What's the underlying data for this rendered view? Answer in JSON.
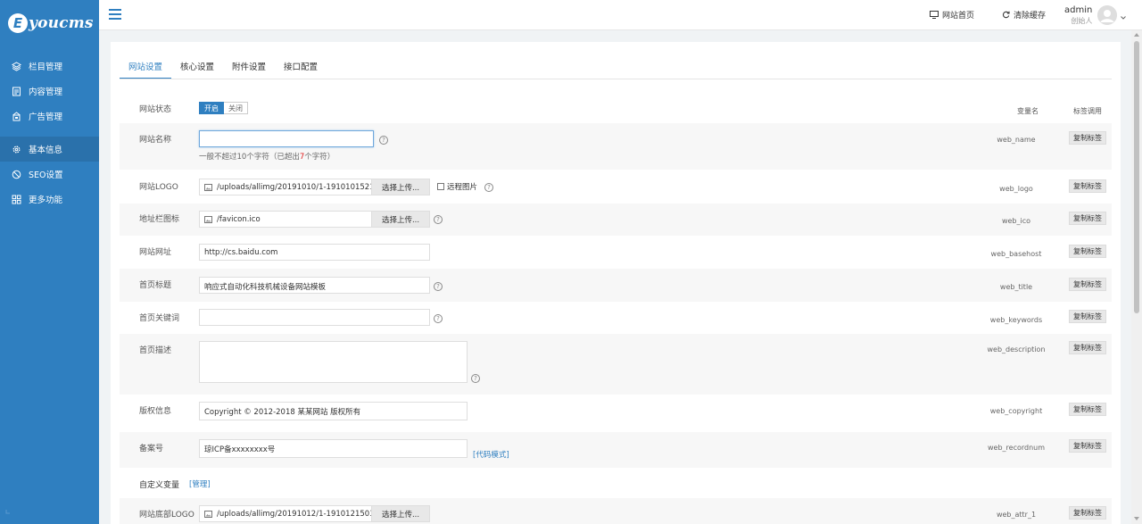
{
  "logo": {
    "mark": "E",
    "text": "youcms"
  },
  "sidebar": {
    "items": [
      {
        "label": "栏目管理",
        "icon": "layers-icon"
      },
      {
        "label": "内容管理",
        "icon": "document-icon"
      },
      {
        "label": "广告管理",
        "icon": "ad-icon"
      },
      {
        "label": "基本信息",
        "icon": "gear-icon",
        "active": true
      },
      {
        "label": "SEO设置",
        "icon": "seo-icon"
      },
      {
        "label": "更多功能",
        "icon": "grid-icon"
      }
    ]
  },
  "header": {
    "home_link": "网站首页",
    "clear_cache": "清除缓存",
    "user_name": "admin",
    "user_role": "创始人"
  },
  "tabs": [
    {
      "label": "网站设置",
      "active": true
    },
    {
      "label": "核心设置"
    },
    {
      "label": "附件设置"
    },
    {
      "label": "接口配置"
    }
  ],
  "columns": {
    "var_name": "变量名",
    "tag_call": "标签调用"
  },
  "copy_label": "复制标签",
  "site_status": {
    "label": "网站状态",
    "on": "开启",
    "off": "关闭"
  },
  "fields": {
    "web_name": {
      "label": "网站名称",
      "value": "",
      "hint_pre": "一般不超过10个字符（已超出",
      "hint_num": "7",
      "hint_post": "个字符）",
      "var": "web_name"
    },
    "web_logo": {
      "label": "网站LOGO",
      "value": "/uploads/allimg/20191010/1-1910101521",
      "button": "选择上传...",
      "remote": "远程图片",
      "var": "web_logo"
    },
    "web_ico": {
      "label": "地址栏图标",
      "value": "/favicon.ico",
      "button": "选择上传...",
      "var": "web_ico"
    },
    "web_basehost": {
      "label": "网站网址",
      "value": "http://cs.baidu.com",
      "var": "web_basehost"
    },
    "web_title": {
      "label": "首页标题",
      "value": "响应式自动化科技机械设备网站模板",
      "var": "web_title"
    },
    "web_keywords": {
      "label": "首页关键词",
      "value": "",
      "var": "web_keywords"
    },
    "web_description": {
      "label": "首页描述",
      "value": "",
      "var": "web_description"
    },
    "web_copyright": {
      "label": "版权信息",
      "value": "Copyright © 2012-2018 某某网站 版权所有",
      "var": "web_copyright"
    },
    "web_recordnum": {
      "label": "备案号",
      "value": "琼ICP备xxxxxxxx号",
      "code_mode": "[代码模式]",
      "var": "web_recordnum"
    },
    "custom": {
      "label": "自定义变量",
      "manage": "[管理]"
    },
    "web_attr_1": {
      "label": "网站底部LOGO",
      "value": "/uploads/allimg/20191012/1-1910121503",
      "button": "选择上传...",
      "var": "web_attr_1"
    }
  },
  "colors": {
    "sidebar": "#2f7fc0",
    "accent": "#2f7fc0",
    "warn": "#e02020"
  }
}
